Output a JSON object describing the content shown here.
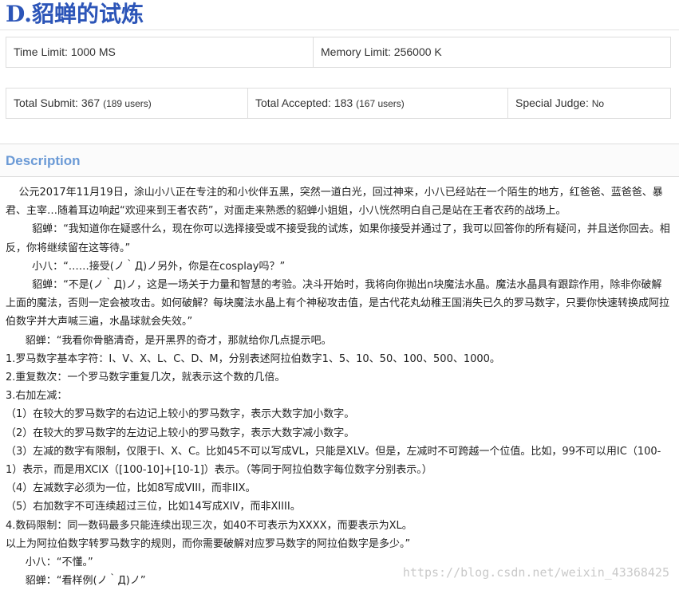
{
  "problem": {
    "title": "D.貂蝉的试炼"
  },
  "limits": {
    "time_label": "Time Limit:",
    "time_value": "1000 MS",
    "memory_label": "Memory Limit:",
    "memory_value": "256000 K"
  },
  "stats": {
    "submit_label": "Total Submit:",
    "submit_value": "367",
    "submit_users": "(189 users)",
    "accepted_label": "Total Accepted:",
    "accepted_value": "183",
    "accepted_users": "(167 users)",
    "judge_label": "Special Judge:",
    "judge_value": "No"
  },
  "description": {
    "heading": "Description",
    "lines": [
      "    公元2017年11月19日，涂山小八正在专注的和小伙伴五黑，突然一道白光，回过神来，小八已经站在一个陌生的地方，红爸爸、蓝爸爸、暴君、主宰…随着耳边响起“欢迎来到王者农药”，对面走来熟悉的貂蝉小姐姐，小八恍然明白自己是站在王者农药的战场上。",
      "        貂蝉：“我知道你在疑惑什么，现在你可以选择接受或不接受我的试炼，如果你接受并通过了，我可以回答你的所有疑问，并且送你回去。相反，你将继续留在这等待。”",
      "        小八：“……接受(ノ｀Д)ノ另外，你是在cosplay吗？”",
      "        貂蝉：“不是(ノ｀Д)ノ，这是一场关于力量和智慧的考验。决斗开始时，我将向你抛出n块魔法水晶。魔法水晶具有跟踪作用，除非你破解上面的魔法，否则一定会被攻击。如何破解？每块魔法水晶上有个神秘攻击值，是古代花丸幼稚王国消失已久的罗马数字，只要你快速转换成阿拉伯数字并大声喊三遍，水晶球就会失效。”",
      "      貂蝉：“我看你骨骼清奇，是开黑界的奇才，那就给你几点提示吧。",
      "1.罗马数字基本字符：I、V、X、L、C、D、M，分别表述阿拉伯数字1、5、10、50、100、500、1000。",
      "2.重复数次：一个罗马数字重复几次，就表示这个数的几倍。",
      "3.右加左减：",
      "（1）在较大的罗马数字的右边记上较小的罗马数字，表示大数字加小数字。",
      "（2）在较大的罗马数字的左边记上较小的罗马数字，表示大数字减小数字。",
      "（3）左减的数字有限制，仅限于I、X、C。比如45不可以写成VL，只能是XLV。但是，左减时不可跨越一个位值。比如，99不可以用IC（100-1）表示，而是用XCIX（[100-10]+[10-1]）表示。（等同于阿拉伯数字每位数字分别表示。）",
      "（4）左减数字必须为一位，比如8写成VIII，而非IIX。",
      "（5）右加数字不可连续超过三位，比如14写成XIV，而非XIIII。",
      "4.数码限制：同一数码最多只能连续出现三次，如40不可表示为XXXX，而要表示为XL。",
      "以上为阿拉伯数字转罗马数字的规则，而你需要破解对应罗马数字的阿拉伯数字是多少。”",
      "      小八：“不懂。”",
      "      貂蝉：“看样例(ノ｀Д)ノ”"
    ]
  },
  "watermark": {
    "text": "https://blog.csdn.net/weixin_43368425"
  }
}
